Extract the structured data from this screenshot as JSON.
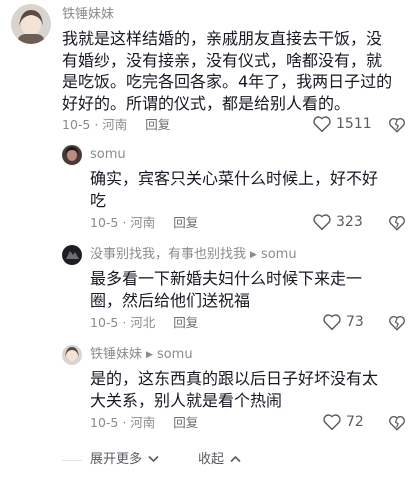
{
  "comment": {
    "author": "铁锤妹妹",
    "lines": [
      "我就是这样结婚的，亲戚朋友直接去干饭，没",
      "有婚纱，没有接亲，没有仪式，啥都没有，就",
      "是吃饭。吃完各回各家。4年了，我两日子过的",
      "好好的。所谓的仪式，都是给别人看的。"
    ],
    "date": "10-5 · 河南",
    "reply_label": "回复",
    "likes": "1511"
  },
  "replies": [
    {
      "author": "somu",
      "reply_to": "",
      "lines": [
        "确实，宾客只关心菜什么时候上，好不好",
        "吃"
      ],
      "date": "10-5 · 河南",
      "reply_label": "回复",
      "likes": "323"
    },
    {
      "author": "没事别找我，有事也别找我",
      "reply_to": "somu",
      "lines": [
        "最多看一下新婚夫妇什么时候下来走一",
        "圈，然后给他们送祝福"
      ],
      "date": "10-5 · 河北",
      "reply_label": "回复",
      "likes": "73"
    },
    {
      "author": "铁锤妹妹",
      "reply_to": "somu",
      "lines": [
        "是的，这东西真的跟以后日子好坏没有太",
        "大关系，别人就是看个热闹"
      ],
      "date": "10-5 · 河南",
      "reply_label": "回复",
      "likes": "72"
    }
  ],
  "footer": {
    "expand_label": "展开更多",
    "collapse_label": "收起"
  },
  "icons": {
    "like": "heart-outline-icon",
    "dislike": "broken-heart-icon",
    "reply_arrow": "caret-right-icon",
    "expand": "chevron-down-icon",
    "collapse": "chevron-up-icon"
  },
  "colors": {
    "text": "#161823",
    "secondary": "#8a8b91",
    "background": "#ffffff"
  }
}
